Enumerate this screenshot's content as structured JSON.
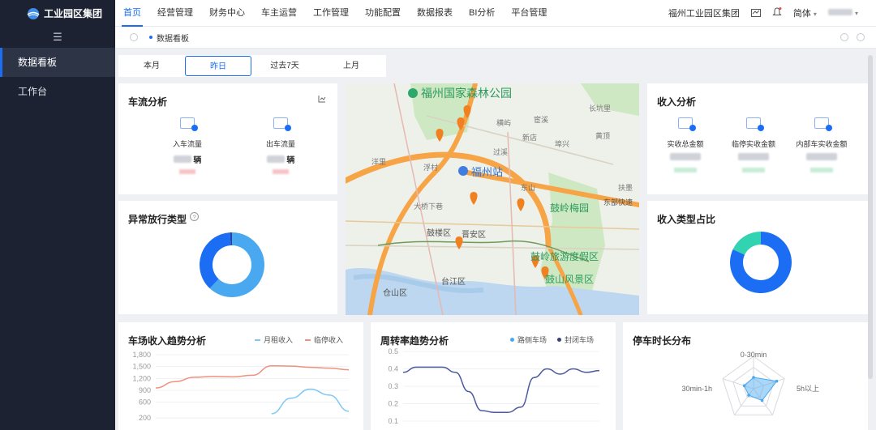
{
  "brand": {
    "name": "工业园区集团"
  },
  "sidebar": {
    "items": [
      {
        "label": "数据看板"
      },
      {
        "label": "工作台"
      }
    ]
  },
  "nav": {
    "items": [
      "首页",
      "经营管理",
      "财务中心",
      "车主运营",
      "工作管理",
      "功能配置",
      "数据报表",
      "BI分析",
      "平台管理"
    ]
  },
  "header": {
    "org": "福州工业园区集团",
    "lang": "简体"
  },
  "tabs": {
    "current": "数据看板"
  },
  "range": {
    "options": [
      "本月",
      "昨日",
      "过去7天",
      "上月"
    ],
    "selected": "昨日"
  },
  "traffic": {
    "title": "车流分析",
    "in_label": "入车流量",
    "out_label": "出车流量",
    "unit": "辆"
  },
  "abnormal": {
    "title": "异常放行类型"
  },
  "income": {
    "title": "收入分析",
    "labels": [
      "实收总金额",
      "临停实收金额",
      "内部车实收金额"
    ]
  },
  "income_type": {
    "title": "收入类型占比"
  },
  "map": {
    "labels": [
      "福州国家森林公园",
      "福州站",
      "鼓岭梅园",
      "鼓岭旅游度假区",
      "鼓山风景区",
      "东部快速",
      "鼓楼区",
      "晋安区",
      "台江区",
      "仓山区",
      "大桥下巷",
      "浮村",
      "横屿",
      "新店",
      "过溪",
      "埠兴",
      "洋里",
      "宦溪",
      "东山",
      "黄顶",
      "扶墨",
      "长坑里"
    ]
  },
  "trend": {
    "title": "车场收入趋势分析",
    "series_a": "月租收入",
    "series_b": "临停收入"
  },
  "turnover": {
    "title": "周转率趋势分析",
    "series_a": "路侧车场",
    "series_b": "封闭车场"
  },
  "duration": {
    "title": "停车时长分布",
    "labels": [
      "0-30min",
      "30min-1h",
      "5h以上"
    ]
  },
  "chart_data": [
    {
      "type": "pie",
      "title": "异常放行类型",
      "values": [
        62,
        37,
        1
      ],
      "colors": [
        "#4aa8f0",
        "#1b6ef3",
        "#2342a8"
      ]
    },
    {
      "type": "pie",
      "title": "收入类型占比",
      "values": [
        82,
        18
      ],
      "colors": [
        "#1b6ef3",
        "#31d3b0"
      ]
    },
    {
      "type": "line",
      "title": "车场收入趋势分析",
      "ylim": [
        0,
        1800
      ],
      "yticks": [
        200,
        600,
        900,
        1200,
        1500,
        1800
      ],
      "ytick_labels": [
        "200",
        "600",
        "900",
        "1,200",
        "1,500",
        "1,800"
      ],
      "x": [
        0,
        1,
        2,
        3,
        4,
        5,
        6,
        7,
        8,
        9,
        10
      ],
      "series": [
        {
          "name": "临停收入",
          "values": [
            960,
            1120,
            1230,
            1250,
            1240,
            1280,
            1520,
            1510,
            1480,
            1460,
            1420
          ],
          "color": "#f0907f"
        },
        {
          "name": "月租收入",
          "values": [
            null,
            null,
            null,
            null,
            null,
            null,
            310,
            700,
            930,
            780,
            370
          ],
          "color": "#7fc7f6"
        }
      ]
    },
    {
      "type": "line",
      "title": "周转率趋势分析",
      "ylim": [
        0.1,
        0.5
      ],
      "yticks": [
        0.1,
        0.2,
        0.3,
        0.4,
        0.5
      ],
      "ytick_labels": [
        "0.1",
        "0.2",
        "0.3",
        "0.4",
        "0.5"
      ],
      "x": [
        0,
        1,
        2,
        3,
        4,
        5,
        6,
        7,
        8,
        9,
        10,
        11,
        12,
        13,
        14,
        15
      ],
      "series": [
        {
          "name": "封闭车场",
          "values": [
            0.38,
            0.41,
            0.41,
            0.41,
            0.38,
            0.27,
            0.16,
            0.15,
            0.15,
            0.18,
            0.35,
            0.4,
            0.37,
            0.4,
            0.38,
            0.39
          ],
          "color": "#4a5a9c"
        }
      ]
    },
    {
      "type": "radar",
      "title": "停车时长分布",
      "axes": [
        "0-30min",
        "5h以上",
        "",
        "",
        "30min-1h"
      ],
      "values": [
        0.35,
        0.75,
        0.45,
        0.25,
        0.3
      ]
    }
  ]
}
